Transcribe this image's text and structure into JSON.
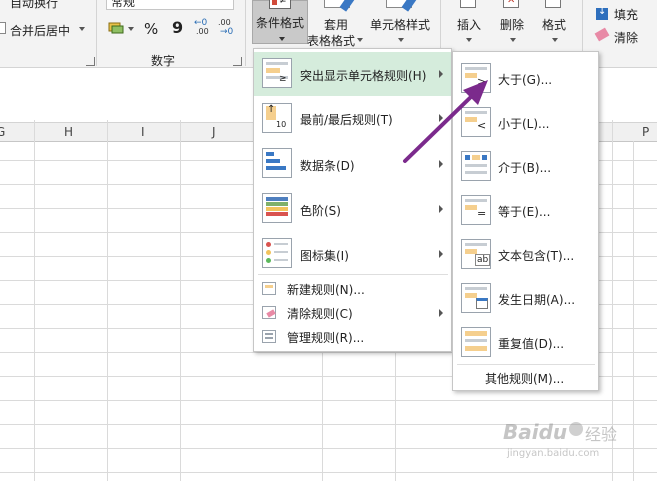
{
  "ribbon": {
    "wrap_text": "自动换行",
    "merge_center": "合并后居中",
    "number_format": "常规",
    "number_group": "数字",
    "percent": "%",
    "comma": "9",
    "inc_decimal": ".00",
    "dec_decimal": ".00",
    "conditional_format": "条件格式",
    "format_as_table_1": "套用",
    "format_as_table_2": "表格格式",
    "cell_styles": "单元格样式",
    "insert": "插入",
    "delete": "删除",
    "format": "格式",
    "fill": "填充",
    "clear": "清除"
  },
  "columns": [
    "G",
    "H",
    "I",
    "J",
    "P"
  ],
  "main_menu": {
    "items": [
      {
        "label": "突出显示单元格规则(H)",
        "highlighted": true,
        "has_submenu": true,
        "icon": "highlight-cells-rules-icon"
      },
      {
        "label": "最前/最后规则(T)",
        "highlighted": false,
        "has_submenu": true,
        "icon": "top-bottom-rules-icon"
      },
      {
        "label": "数据条(D)",
        "highlighted": false,
        "has_submenu": true,
        "icon": "data-bars-icon"
      },
      {
        "label": "色阶(S)",
        "highlighted": false,
        "has_submenu": true,
        "icon": "color-scales-icon"
      },
      {
        "label": "图标集(I)",
        "highlighted": false,
        "has_submenu": true,
        "icon": "icon-sets-icon"
      }
    ],
    "small_items": [
      {
        "label": "新建规则(N)...",
        "has_submenu": false,
        "icon": "new-rule-icon"
      },
      {
        "label": "清除规则(C)",
        "has_submenu": true,
        "icon": "clear-rules-icon"
      },
      {
        "label": "管理规则(R)...",
        "has_submenu": false,
        "icon": "manage-rules-icon"
      }
    ]
  },
  "sub_menu": {
    "items": [
      {
        "label": "大于(G)...",
        "glyph": ">",
        "icon": "greater-than-icon"
      },
      {
        "label": "小于(L)...",
        "glyph": "<",
        "icon": "less-than-icon"
      },
      {
        "label": "介于(B)...",
        "glyph": "",
        "icon": "between-icon"
      },
      {
        "label": "等于(E)...",
        "glyph": "=",
        "icon": "equal-to-icon"
      },
      {
        "label": "文本包含(T)...",
        "glyph": "ab",
        "icon": "text-contains-icon"
      },
      {
        "label": "发生日期(A)...",
        "glyph": "",
        "icon": "date-occurring-icon"
      },
      {
        "label": "重复值(D)...",
        "glyph": "",
        "icon": "duplicate-values-icon"
      }
    ],
    "more_rules": "其他规则(M)..."
  },
  "watermark": {
    "brand": "Baidu",
    "cn": "经验",
    "url": "jingyan.baidu.com"
  },
  "colors": {
    "highlight": "#d5ecdc",
    "arrow": "#7b2a8c",
    "ribbon_bg": "#f3f3f3",
    "cell_fill": "#f5cf8e"
  }
}
